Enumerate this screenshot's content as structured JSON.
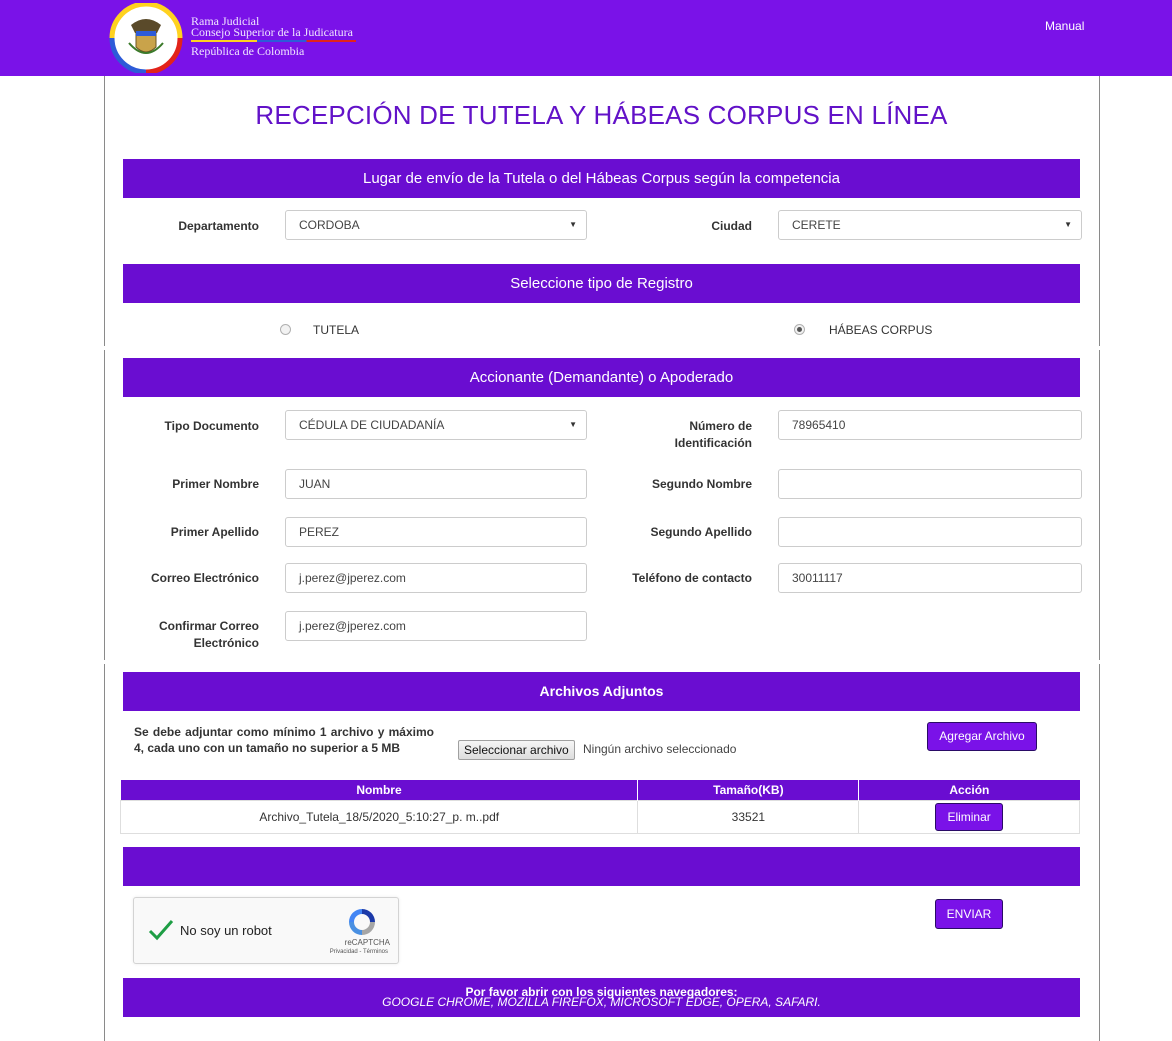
{
  "header": {
    "org_line1": "Rama Judicial",
    "org_line2": "Consejo Superior de la Judicatura",
    "org_line3": "República de Colombia",
    "manual_link": "Manual"
  },
  "page_title": "RECEPCIÓN DE TUTELA Y HÁBEAS CORPUS EN LÍNEA",
  "location_section": {
    "heading": "Lugar de envío de la Tutela o del Hábeas Corpus según la competencia",
    "departamento_label": "Departamento",
    "departamento_value": "CORDOBA",
    "ciudad_label": "Ciudad",
    "ciudad_value": "CERETE"
  },
  "registro_section": {
    "heading": "Seleccione tipo de Registro",
    "option_tutela": "TUTELA",
    "option_habeas": "HÁBEAS CORPUS",
    "selected": "HÁBEAS CORPUS"
  },
  "accionante_section": {
    "heading": "Accionante (Demandante) o Apoderado",
    "tipo_documento_label": "Tipo Documento",
    "tipo_documento_value": "CÉDULA DE CIUDADANÍA",
    "numero_id_label_1": "Número de",
    "numero_id_label_2": "Identificación",
    "numero_id_value": "78965410",
    "primer_nombre_label": "Primer Nombre",
    "primer_nombre_value": "JUAN",
    "segundo_nombre_label": "Segundo Nombre",
    "segundo_nombre_value": "",
    "primer_apellido_label": "Primer Apellido",
    "primer_apellido_value": "PEREZ",
    "segundo_apellido_label": "Segundo Apellido",
    "segundo_apellido_value": "",
    "correo_label": "Correo Electrónico",
    "correo_value": "j.perez@jperez.com",
    "telefono_label": "Teléfono de contacto",
    "telefono_value": "30011117",
    "confirmar_correo_label_1": "Confirmar Correo",
    "confirmar_correo_label_2": "Electrónico",
    "confirmar_correo_value": "j.perez@jperez.com"
  },
  "archivos_section": {
    "heading": "Archivos Adjuntos",
    "note": "Se debe adjuntar como mínimo 1 archivo y máximo 4, cada uno con un tamaño no superior a 5 MB",
    "select_button": "Seleccionar archivo",
    "no_file_text": "Ningún archivo seleccionado",
    "add_button": "Agregar Archivo",
    "columns": [
      "Nombre",
      "Tamaño(KB)",
      "Acción"
    ],
    "rows": [
      {
        "nombre": "Archivo_Tutela_18/5/2020_5:10:27_p. m..pdf",
        "tamano": "33521",
        "accion": "Eliminar"
      }
    ]
  },
  "captcha": {
    "label": "No soy un robot",
    "brand": "reCAPTCHA",
    "terms": "Privacidad - Términos"
  },
  "submit_button": "ENVIAR",
  "footer": {
    "line1": "Por favor abrir con los siguientes navegadores:",
    "line2": "GOOGLE CHROME, MOZILLA FIREFOX, MICROSOFT EDGE, OPERA, SAFARI."
  },
  "colors": {
    "brand_purple": "#7a12e8",
    "band_purple": "#6a0dd1",
    "title_purple": "#6212c8"
  }
}
